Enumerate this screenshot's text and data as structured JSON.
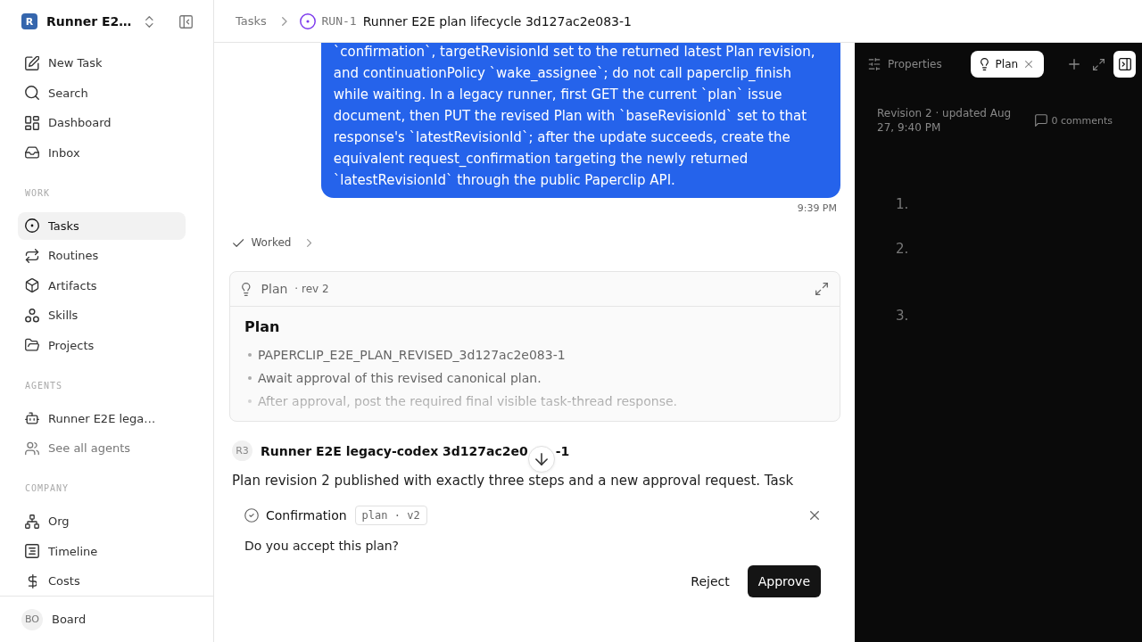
{
  "header": {
    "breadcrumb": "Tasks",
    "run_id": "RUN-1",
    "title": "Runner E2E plan lifecycle 3d127ac2e083-1"
  },
  "sidebar": {
    "workspace": {
      "initial": "R",
      "name": "Runner E2…"
    },
    "nav": [
      {
        "label": "New Task",
        "selected": false
      },
      {
        "label": "Search",
        "selected": false
      },
      {
        "label": "Dashboard",
        "selected": false
      },
      {
        "label": "Inbox",
        "selected": false
      }
    ],
    "sections": [
      {
        "title": "WORK",
        "items": [
          {
            "label": "Tasks",
            "selected": true
          },
          {
            "label": "Routines",
            "selected": false
          },
          {
            "label": "Artifacts",
            "selected": false
          },
          {
            "label": "Skills",
            "selected": false
          },
          {
            "label": "Projects",
            "selected": false
          }
        ]
      },
      {
        "title": "AGENTS",
        "items": [
          {
            "kind": "agent",
            "label": "Runner E2E lega…",
            "selected": false
          },
          {
            "kind": "link",
            "label": "See all agents",
            "selected": false
          }
        ]
      },
      {
        "title": "COMPANY",
        "items": [
          {
            "label": "Org",
            "selected": false
          },
          {
            "label": "Timeline",
            "selected": false
          },
          {
            "label": "Costs",
            "selected": false
          }
        ]
      }
    ],
    "user": {
      "initials": "BO",
      "name": "Board"
    }
  },
  "thread": {
    "user_message": {
      "text": "`confirmation`, targetRevisionId set to the returned latest Plan revision, and continuationPolicy `wake_assignee`; do not call paperclip_finish while waiting. In a legacy runner, first GET the current `plan` issue document, then PUT the revised Plan with `baseRevisionId` set to that response's `latestRevisionId`; after the update succeeds, create the equivalent request_confirmation targeting the newly returned `latestRevisionId` through the public Paperclip API.",
      "time": "9:39 PM"
    },
    "activity": {
      "label": "Worked",
      "expanded": false
    },
    "plan_card": {
      "label": "Plan",
      "revision": "· rev 2",
      "heading": "Plan",
      "steps": [
        "PAPERCLIP_E2E_PLAN_REVISED_3d127ac2e083-1",
        "Await approval of this revised canonical plan.",
        "After approval, post the required final visible task-thread response."
      ]
    },
    "agent_message": {
      "avatar": "R3",
      "author_parts": [
        "Runner E2E legacy-codex 3d127ac2e0",
        "-1"
      ],
      "text": "Plan revision 2 published with exactly three steps and a new approval request. Task"
    }
  },
  "confirmation": {
    "title": "Confirmation",
    "tag": "plan · v2",
    "question": "Do you accept this plan?",
    "buttons": [
      {
        "label": "Reject",
        "kind": "secondary"
      },
      {
        "label": "Approve",
        "kind": "primary"
      }
    ]
  },
  "side_panel": {
    "tabs": [
      {
        "label": "Properties",
        "selected": false,
        "closable": false
      },
      {
        "label": "Plan",
        "selected": true,
        "closable": true
      }
    ],
    "meta": "Revision 2 · updated Aug 27, 9:40 PM",
    "comments": "0 comments",
    "step_numbers": [
      "1.",
      "2.",
      "3."
    ]
  }
}
